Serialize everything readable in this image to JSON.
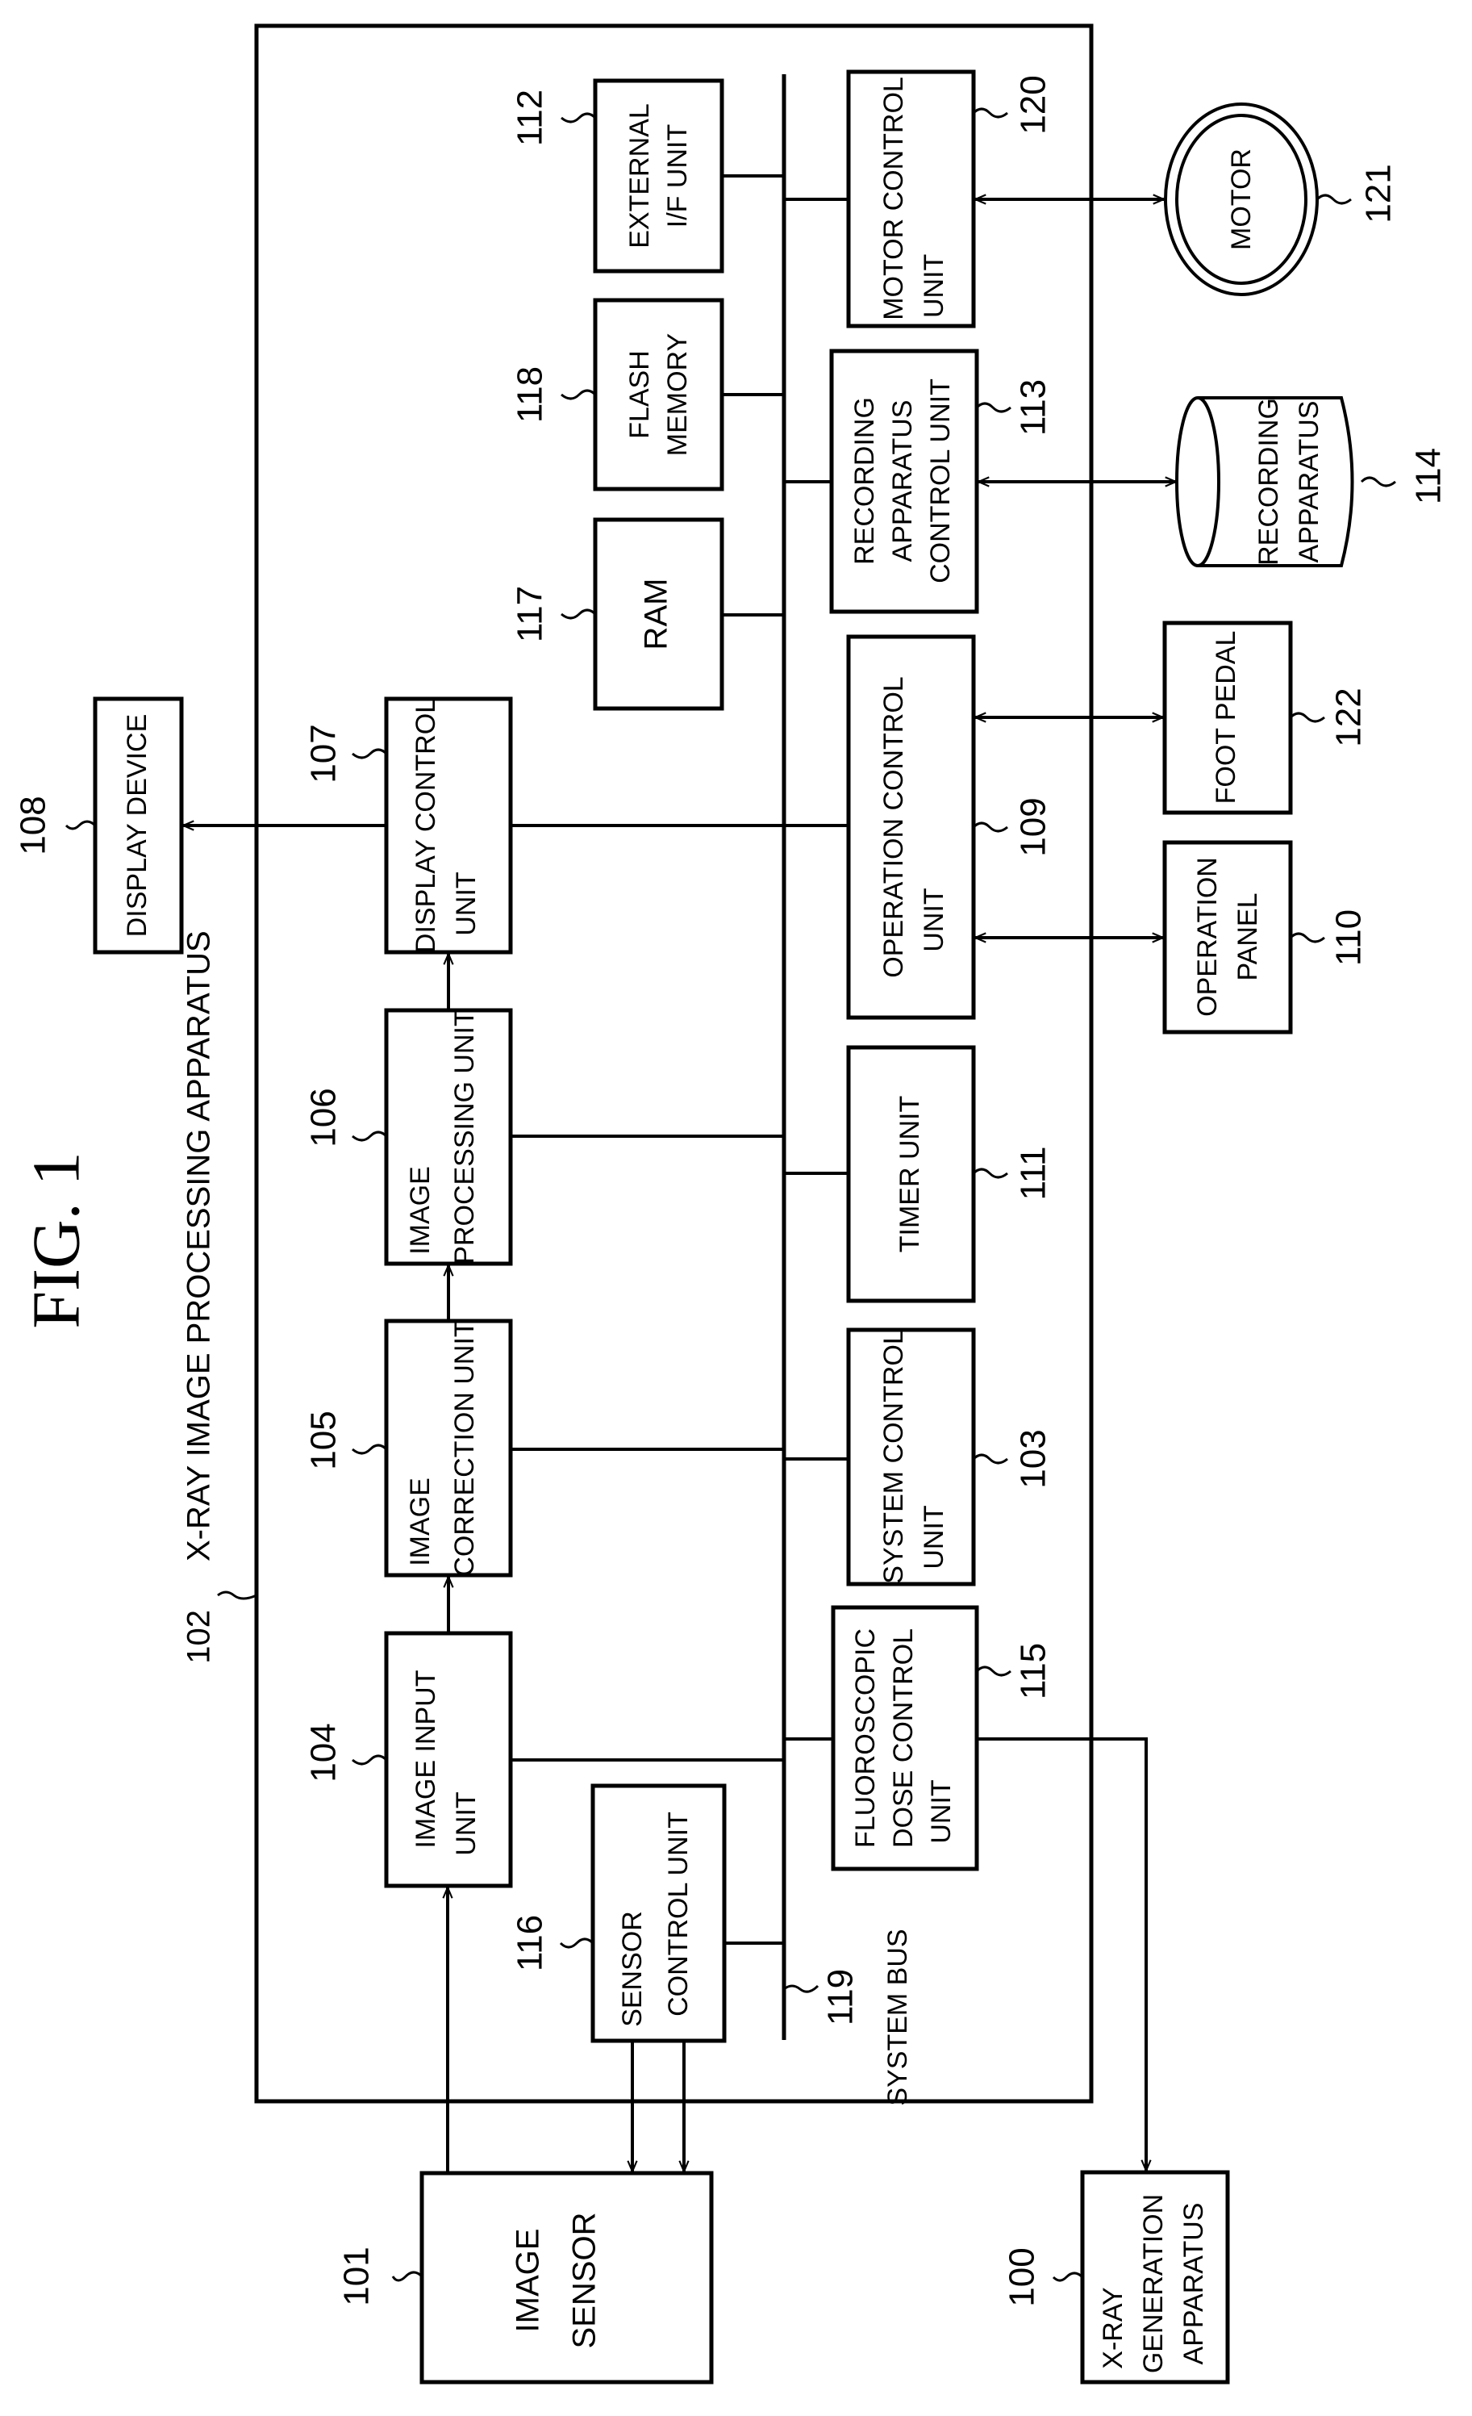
{
  "figure": {
    "title": "FIG. 1"
  },
  "apparatus": {
    "ref": "102",
    "label": "X-RAY IMAGE PROCESSING  APPARATUS"
  },
  "blocks": {
    "xray_generation": {
      "ref": "100",
      "lines": [
        "X-RAY",
        "GENERATION",
        "APPARATUS"
      ]
    },
    "image_sensor": {
      "ref": "101",
      "lines": [
        "IMAGE",
        "SENSOR"
      ]
    },
    "system_control": {
      "ref": "103",
      "lines": [
        "SYSTEM CONTROL",
        "UNIT"
      ]
    },
    "image_input": {
      "ref": "104",
      "lines": [
        "IMAGE INPUT",
        "UNIT"
      ]
    },
    "image_correction": {
      "ref": "105",
      "lines": [
        "IMAGE",
        "CORRECTION UNIT"
      ]
    },
    "image_processing": {
      "ref": "106",
      "lines": [
        "IMAGE",
        "PROCESSING UNIT"
      ]
    },
    "display_control": {
      "ref": "107",
      "lines": [
        "DISPLAY CONTROL",
        "UNIT"
      ]
    },
    "display_device": {
      "ref": "108",
      "lines": [
        "DISPLAY DEVICE"
      ]
    },
    "operation_control": {
      "ref": "109",
      "lines": [
        "OPERATION CONTROL",
        "UNIT"
      ]
    },
    "operation_panel": {
      "ref": "110",
      "lines": [
        "OPERATION",
        "PANEL"
      ]
    },
    "timer": {
      "ref": "111",
      "lines": [
        "TIMER UNIT"
      ]
    },
    "external_if": {
      "ref": "112",
      "lines": [
        "EXTERNAL",
        "I/F UNIT"
      ]
    },
    "recording_control": {
      "ref": "113",
      "lines": [
        "RECORDING",
        "APPARATUS",
        "CONTROL UNIT"
      ]
    },
    "recording_apparatus": {
      "ref": "114",
      "lines": [
        "RECORDING",
        "APPARATUS"
      ]
    },
    "fluoroscopic_dose": {
      "ref": "115",
      "lines": [
        "FLUOROSCOPIC",
        "DOSE CONTROL",
        "UNIT"
      ]
    },
    "sensor_control": {
      "ref": "116",
      "lines": [
        "SENSOR",
        "CONTROL UNIT"
      ]
    },
    "ram": {
      "ref": "117",
      "lines": [
        "RAM"
      ]
    },
    "flash_memory": {
      "ref": "118",
      "lines": [
        "FLASH",
        "MEMORY"
      ]
    },
    "motor_control": {
      "ref": "120",
      "lines": [
        "MOTOR CONTROL",
        "UNIT"
      ]
    },
    "motor": {
      "ref": "121",
      "lines": [
        "MOTOR"
      ]
    },
    "foot_pedal": {
      "ref": "122",
      "lines": [
        "FOOT PEDAL"
      ]
    }
  },
  "system_bus": {
    "ref": "119",
    "label": "SYSTEM BUS"
  }
}
